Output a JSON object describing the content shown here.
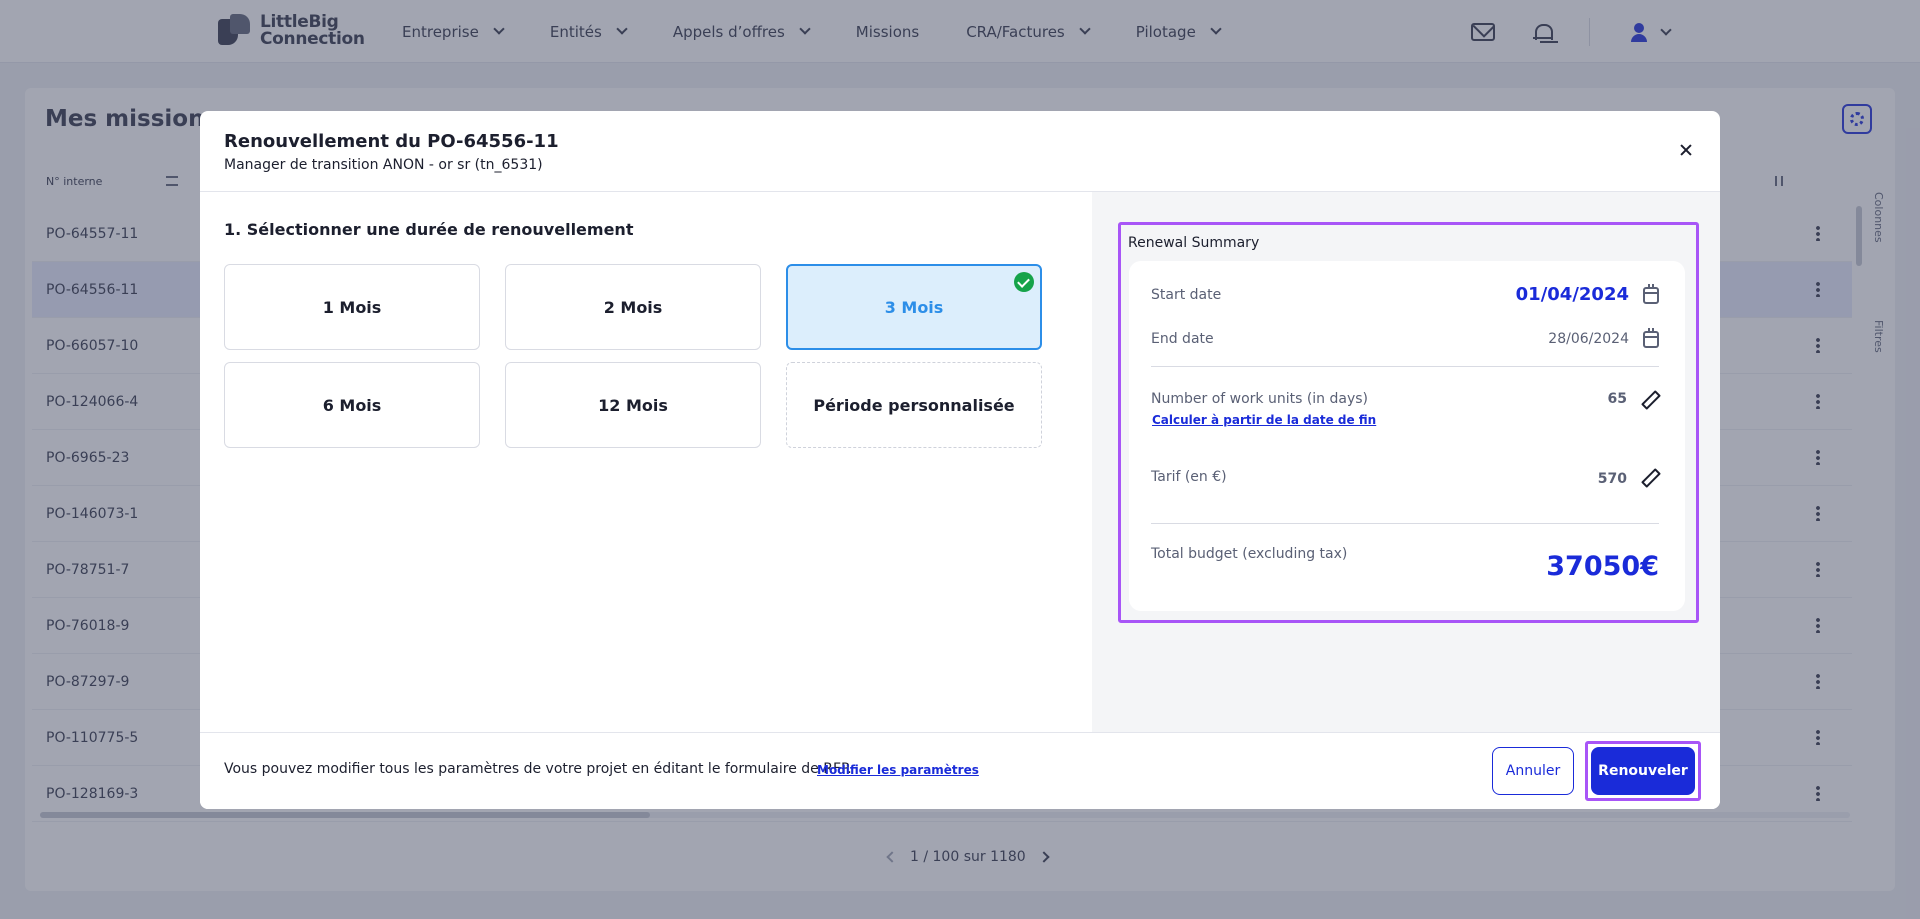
{
  "brand": {
    "line1": "LittleBig",
    "line2": "Connection"
  },
  "nav": [
    {
      "label": "Entreprise",
      "has_menu": true
    },
    {
      "label": "Entités",
      "has_menu": true
    },
    {
      "label": "Appels d’offres",
      "has_menu": true
    },
    {
      "label": "Missions",
      "has_menu": false
    },
    {
      "label": "CRA/Factures",
      "has_menu": true
    },
    {
      "label": "Pilotage",
      "has_menu": true
    }
  ],
  "page": {
    "title": "Mes missions",
    "column_header": "N° interne",
    "side_labels": {
      "columns": "Colonnes",
      "filters": "Filtres"
    },
    "rows": [
      "PO-64557-11",
      "PO-64556-11",
      "PO-66057-10",
      "PO-124066-4",
      "PO-6965-23",
      "PO-146073-1",
      "PO-78751-7",
      "PO-76018-9",
      "PO-87297-9",
      "PO-110775-5",
      "PO-128169-3"
    ],
    "active_row": 1,
    "pagination": "1 / 100 sur 1180"
  },
  "modal": {
    "title": "Renouvellement du PO-64556-11",
    "subtitle": "Manager de transition ANON - or sr (tn_6531)",
    "section_title": "1. Sélectionner une durée de renouvellement",
    "options": [
      {
        "label": "1 Mois",
        "selected": false
      },
      {
        "label": "2 Mois",
        "selected": false
      },
      {
        "label": "3 Mois",
        "selected": true
      },
      {
        "label": "6 Mois",
        "selected": false
      },
      {
        "label": "12 Mois",
        "selected": false
      },
      {
        "label": "Période personnalisée",
        "selected": false
      }
    ],
    "summary": {
      "heading": "Renewal Summary",
      "start_label": "Start date",
      "start_value": "01/04/2024",
      "end_label": "End date",
      "end_value": "28/06/2024",
      "units_label": "Number of work units (in days)",
      "units_value": "65",
      "calc_link": "Calculer à partir de la date de fin",
      "rate_label": "Tarif (en €)",
      "rate_value": "570",
      "total_label": "Total budget (excluding tax)",
      "total_value": "37050€"
    },
    "footer_text": "Vous pouvez modifier tous les paramètres de votre projet en éditant le formulaire de RFP.",
    "footer_link": "Modifier les paramètres",
    "cancel_label": "Annuler",
    "renew_label": "Renouveler"
  },
  "colors": {
    "primary": "#1a2bd9",
    "selected_bg": "#dceefc",
    "selected_border": "#2c8ee8",
    "highlight": "#a855f7",
    "success": "#16a34a"
  }
}
